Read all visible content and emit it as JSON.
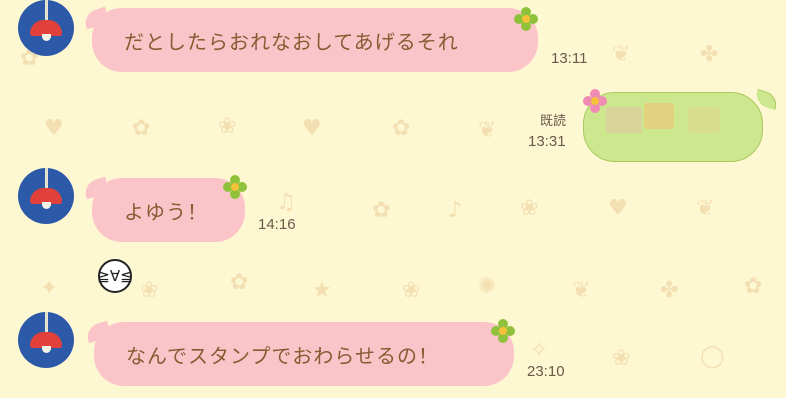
{
  "messages": [
    {
      "text": "だとしたらおれなおしてあげるそれ",
      "time": "13:11"
    },
    {
      "read_label": "既読",
      "time": "13:31"
    },
    {
      "text": "よゆう！",
      "time": "14:16"
    },
    {
      "text": "なんでスタンプでおわらせるの！",
      "time": "23:10"
    }
  ],
  "sticker": {
    "face": "≧∀≦"
  },
  "colors": {
    "background": "#fdf7d2",
    "incoming_bubble": "#fbc4c9",
    "outgoing_bubble": "#cde78e",
    "message_text": "#8a5a32",
    "avatar_blue": "#2c5aa8",
    "avatar_lamp_red": "#e0413a"
  },
  "icons": [
    "avatar-lamp-icon",
    "green-flower-icon",
    "pink-flower-icon",
    "sticker-face-icon"
  ]
}
